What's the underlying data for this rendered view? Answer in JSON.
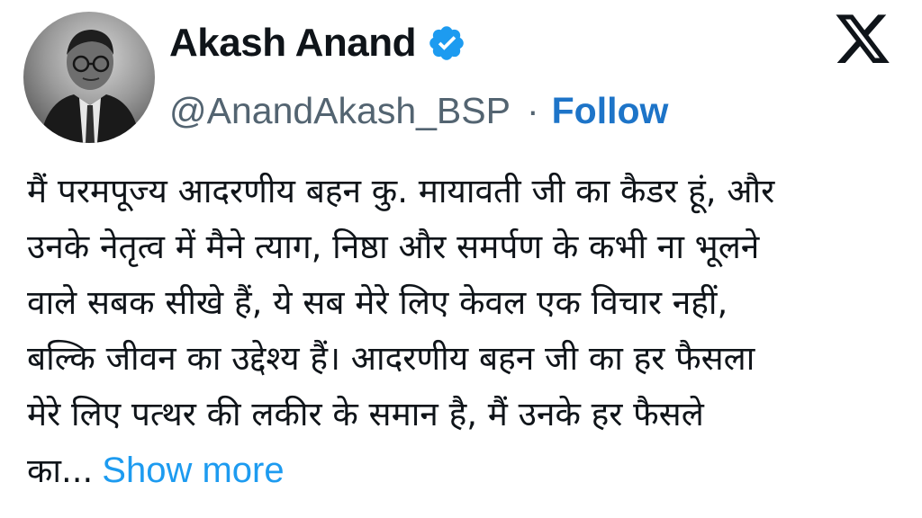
{
  "author": {
    "display_name": "Akash Anand",
    "handle": "@AnandAkash_BSP",
    "separator": "·",
    "follow_label": "Follow",
    "verified_icon": "verified-badge-icon",
    "avatar_icon": "avatar"
  },
  "platform": {
    "logo_icon": "x-logo-icon"
  },
  "tweet": {
    "lines": [
      "मैं परमपूज्य आदरणीय बहन कु. मायावती जी का कैडर हूं, और",
      "उनके नेतृत्व में मैने त्याग, निष्ठा और समर्पण के कभी ना भूलने",
      "वाले सबक सीखे हैं, ये सब मेरे लिए केवल एक विचार नहीं,",
      "बल्कि जीवन का उद्देश्य हैं। आदरणीय बहन जी का हर फैसला",
      "मेरे लिए पत्थर की लकीर के समान है, मैं उनके हर फैसले",
      "का..."
    ],
    "show_more_label": "Show more"
  },
  "colors": {
    "text": "#0f1419",
    "secondary": "#536471",
    "follow": "#1d74c8",
    "show_more": "#1d9bf0",
    "verified": "#1d9bf0"
  }
}
